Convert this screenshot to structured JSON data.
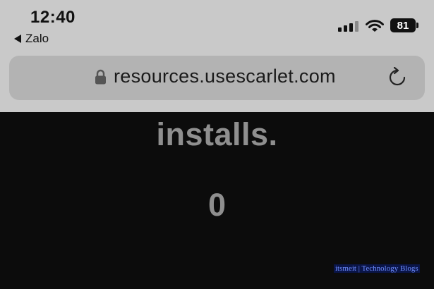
{
  "status_bar": {
    "time": "12:40",
    "back_app": "Zalo",
    "battery_level": "81",
    "icons": [
      "cellular-signal-icon",
      "wifi-icon",
      "battery-icon"
    ]
  },
  "browser": {
    "url": "resources.usescarlet.com",
    "icons": [
      "lock-icon",
      "reload-icon"
    ]
  },
  "page": {
    "heading": "installs.",
    "count": "0"
  },
  "watermark": {
    "text": "itsmeit | Technology Blogs"
  },
  "colors": {
    "status_area_bg": "#c9c9c9",
    "url_bar_bg": "#b3b3b3",
    "page_bg": "#0c0c0c",
    "content_text": "#8f8f8f",
    "watermark_text": "#6f8dff",
    "watermark_bg": "#0a1548"
  }
}
